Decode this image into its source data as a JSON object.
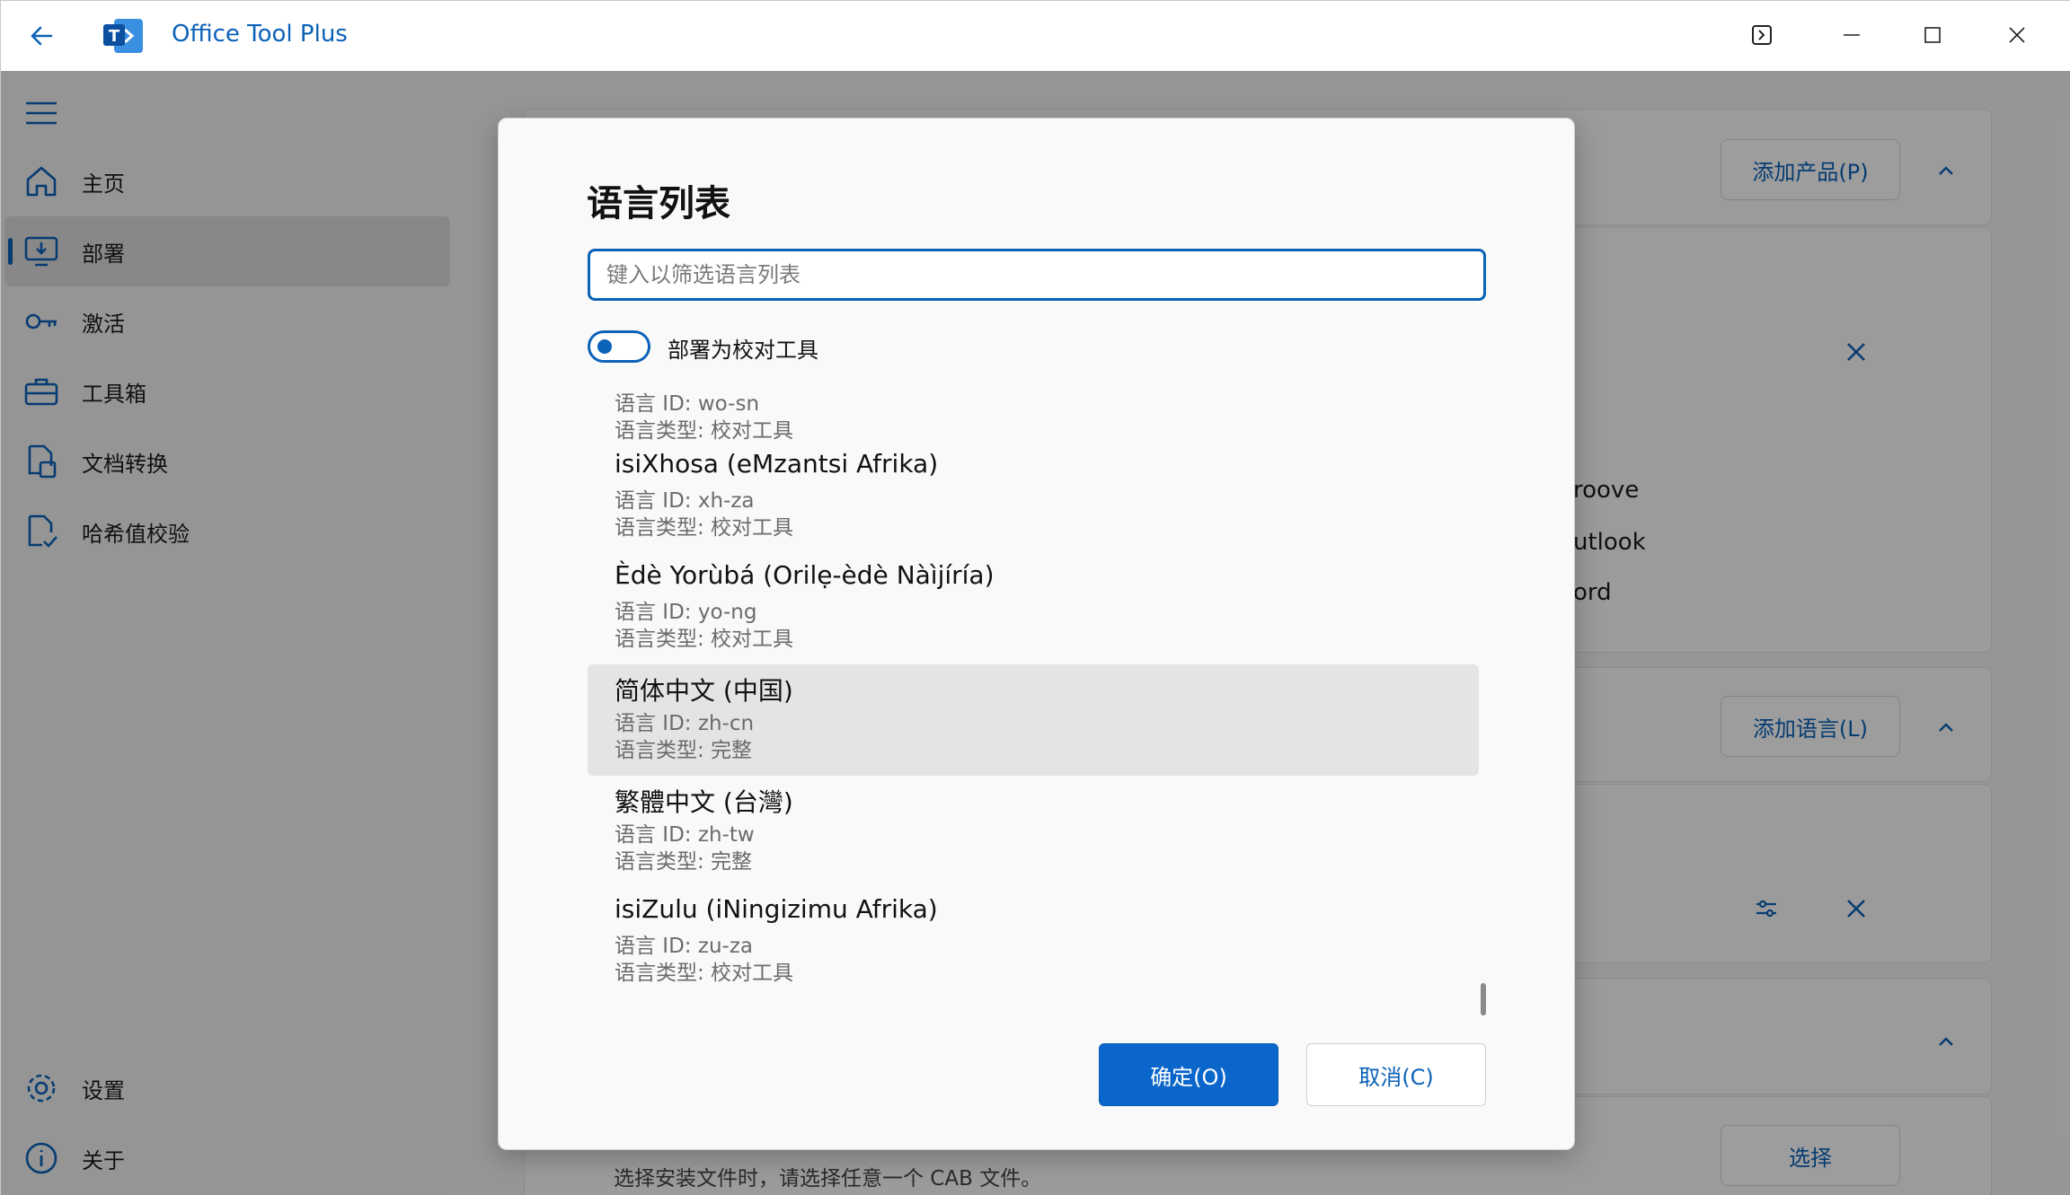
{
  "app": {
    "title": "Office Tool Plus"
  },
  "sidebar": {
    "items": [
      {
        "label": "主页",
        "icon": "home-icon"
      },
      {
        "label": "部署",
        "icon": "deploy-icon",
        "active": true
      },
      {
        "label": "激活",
        "icon": "key-icon"
      },
      {
        "label": "工具箱",
        "icon": "toolbox-icon"
      },
      {
        "label": "文档转换",
        "icon": "doc-convert-icon"
      },
      {
        "label": "哈希值校验",
        "icon": "hash-check-icon"
      }
    ],
    "footer": [
      {
        "label": "设置",
        "icon": "gear-icon"
      },
      {
        "label": "关于",
        "icon": "info-icon"
      }
    ]
  },
  "background": {
    "add_product_label": "添加产品(P)",
    "add_language_label": "添加语言(L)",
    "select_label": "选择",
    "partial_products": [
      "roove",
      "utlook",
      "ord"
    ],
    "cab_hint": "选择安装文件时，请选择任意一个 CAB 文件。"
  },
  "dialog": {
    "title": "语言列表",
    "filter_placeholder": "键入以筛选语言列表",
    "filter_value": "",
    "toggle_label": "部署为校对工具",
    "toggle_on": true,
    "languages": [
      {
        "name": "",
        "id": "语言 ID: wo-sn",
        "type": "语言类型: 校对工具"
      },
      {
        "name": "isiXhosa (eMzantsi Afrika)",
        "id": "语言 ID: xh-za",
        "type": "语言类型: 校对工具"
      },
      {
        "name": "Èdè Yorùbá (Orilẹ-èdè Nàìjíría)",
        "id": "语言 ID: yo-ng",
        "type": "语言类型: 校对工具"
      },
      {
        "name": "简体中文 (中国)",
        "id": "语言 ID: zh-cn",
        "type": "语言类型: 完整",
        "selected": true
      },
      {
        "name": "繁體中文 (台灣)",
        "id": "语言 ID: zh-tw",
        "type": "语言类型: 完整"
      },
      {
        "name": "isiZulu (iNingizimu Afrika)",
        "id": "语言 ID: zu-za",
        "type": "语言类型: 校对工具"
      }
    ],
    "ok_label": "确定(O)",
    "cancel_label": "取消(C)"
  },
  "colors": {
    "accent": "#0b62b8",
    "primary_button": "#0b66cc"
  }
}
